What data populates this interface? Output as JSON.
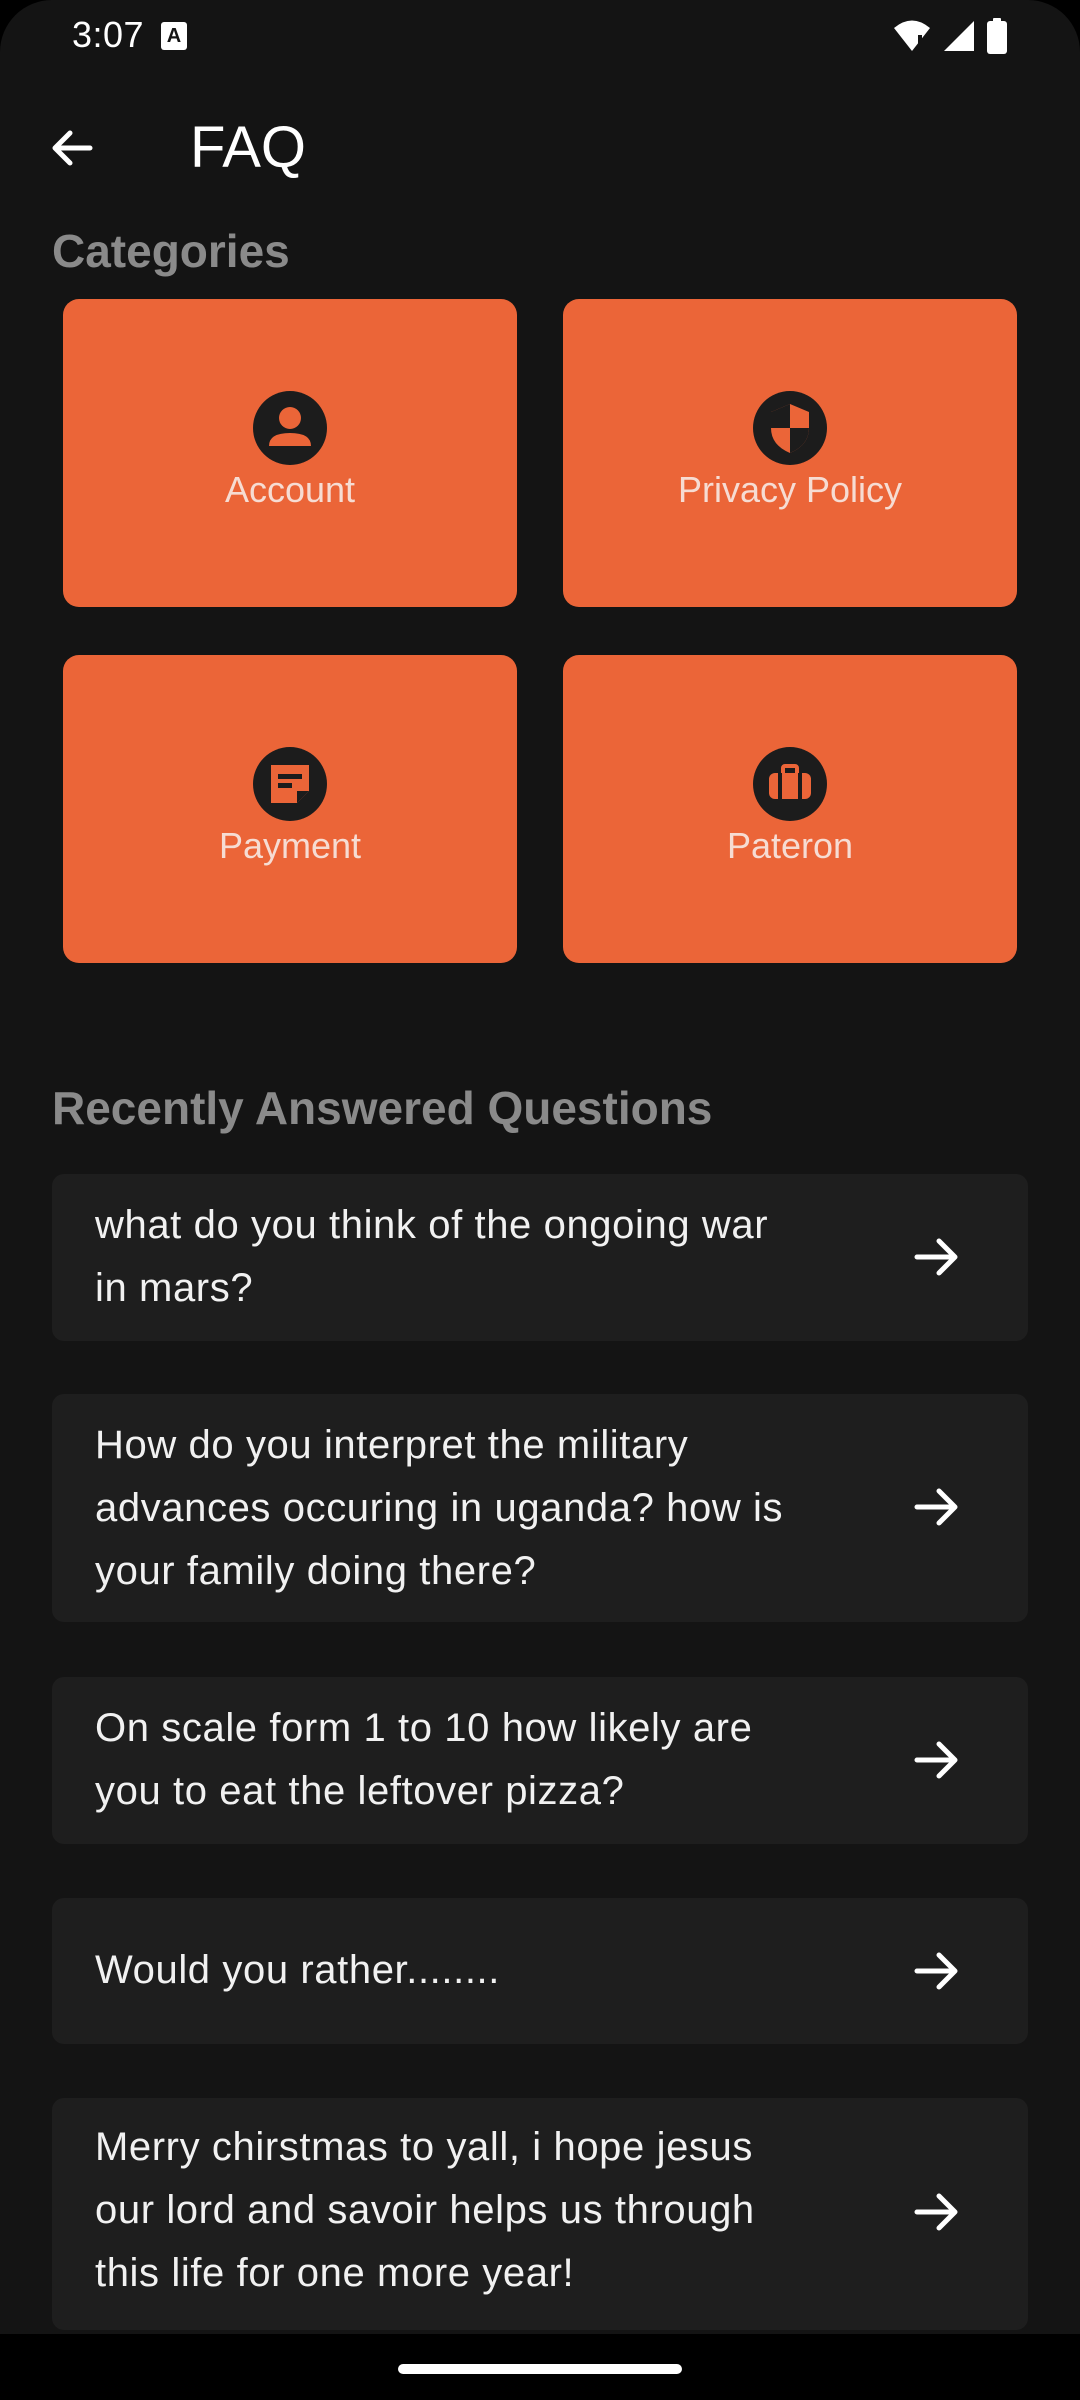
{
  "status_bar": {
    "time": "3:07",
    "notification_icon": "A",
    "icons": [
      "wifi-icon",
      "signal-icon",
      "battery-icon"
    ]
  },
  "app_bar": {
    "title": "FAQ",
    "back_icon": "arrow-left-icon"
  },
  "categories": {
    "heading": "Categories",
    "items": [
      {
        "label": "Account",
        "icon": "account-circle-icon"
      },
      {
        "label": "Privacy Policy",
        "icon": "shield-icon"
      },
      {
        "label": "Payment",
        "icon": "sticky-note-icon"
      },
      {
        "label": "Pateron",
        "icon": "suitcase-icon"
      }
    ]
  },
  "recent": {
    "heading": "Recently Answered Questions",
    "items": [
      {
        "line1": "what do you think of the ongoing war",
        "line2": "in mars?",
        "line3": ""
      },
      {
        "line1": "How do you interpret the military",
        "line2": "advances occuring in uganda? how is",
        "line3": "your family doing there?"
      },
      {
        "line1": "On scale form 1 to 10 how likely are",
        "line2": "you to eat the leftover pizza?",
        "line3": ""
      },
      {
        "line1": "Would you rather........",
        "line2": "",
        "line3": ""
      },
      {
        "line1": "Merry chirstmas to yall, i hope jesus",
        "line2": "our lord and savoir helps us through",
        "line3": "this life for one more year!"
      }
    ]
  },
  "colors": {
    "background": "#141414",
    "card_accent": "#eb6538",
    "row_background": "#1e1e1e",
    "heading_text": "#8a8a8a"
  }
}
